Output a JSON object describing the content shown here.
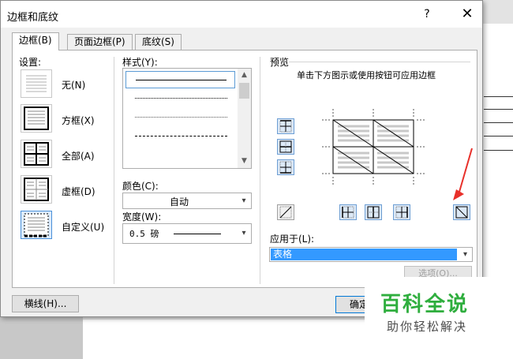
{
  "dialog": {
    "title": "边框和底纹",
    "help": "?",
    "close": "✕"
  },
  "tabs": [
    {
      "label": "边框(B)",
      "active": true
    },
    {
      "label": "页面边框(P)",
      "active": false
    },
    {
      "label": "底纹(S)",
      "active": false
    }
  ],
  "settings": {
    "heading": "设置:",
    "items": [
      {
        "label": "无(N)",
        "selected": false
      },
      {
        "label": "方框(X)",
        "selected": false
      },
      {
        "label": "全部(A)",
        "selected": false
      },
      {
        "label": "虚框(D)",
        "selected": false
      },
      {
        "label": "自定义(U)",
        "selected": true
      }
    ]
  },
  "style": {
    "heading": "样式(Y):",
    "selected_index": 0
  },
  "color": {
    "label": "颜色(C):",
    "value": "自动"
  },
  "width": {
    "label": "宽度(W):",
    "value": "0.5 磅"
  },
  "preview": {
    "heading": "预览",
    "hint": "单击下方图示或使用按钮可应用边框"
  },
  "apply_to": {
    "label": "应用于(L):",
    "value": "表格"
  },
  "buttons": {
    "options": "选项(O)...",
    "horizontal_line": "横线(H)...",
    "ok": "确定"
  },
  "watermark": {
    "title": "百科全说",
    "subtitle": "助你轻松解决"
  },
  "colors": {
    "accent": "#3399ff",
    "button_border": "#6d9ed4",
    "button_fill": "#dce9f7",
    "arrow": "#e8302a",
    "watermark_green": "#2fae3e"
  }
}
